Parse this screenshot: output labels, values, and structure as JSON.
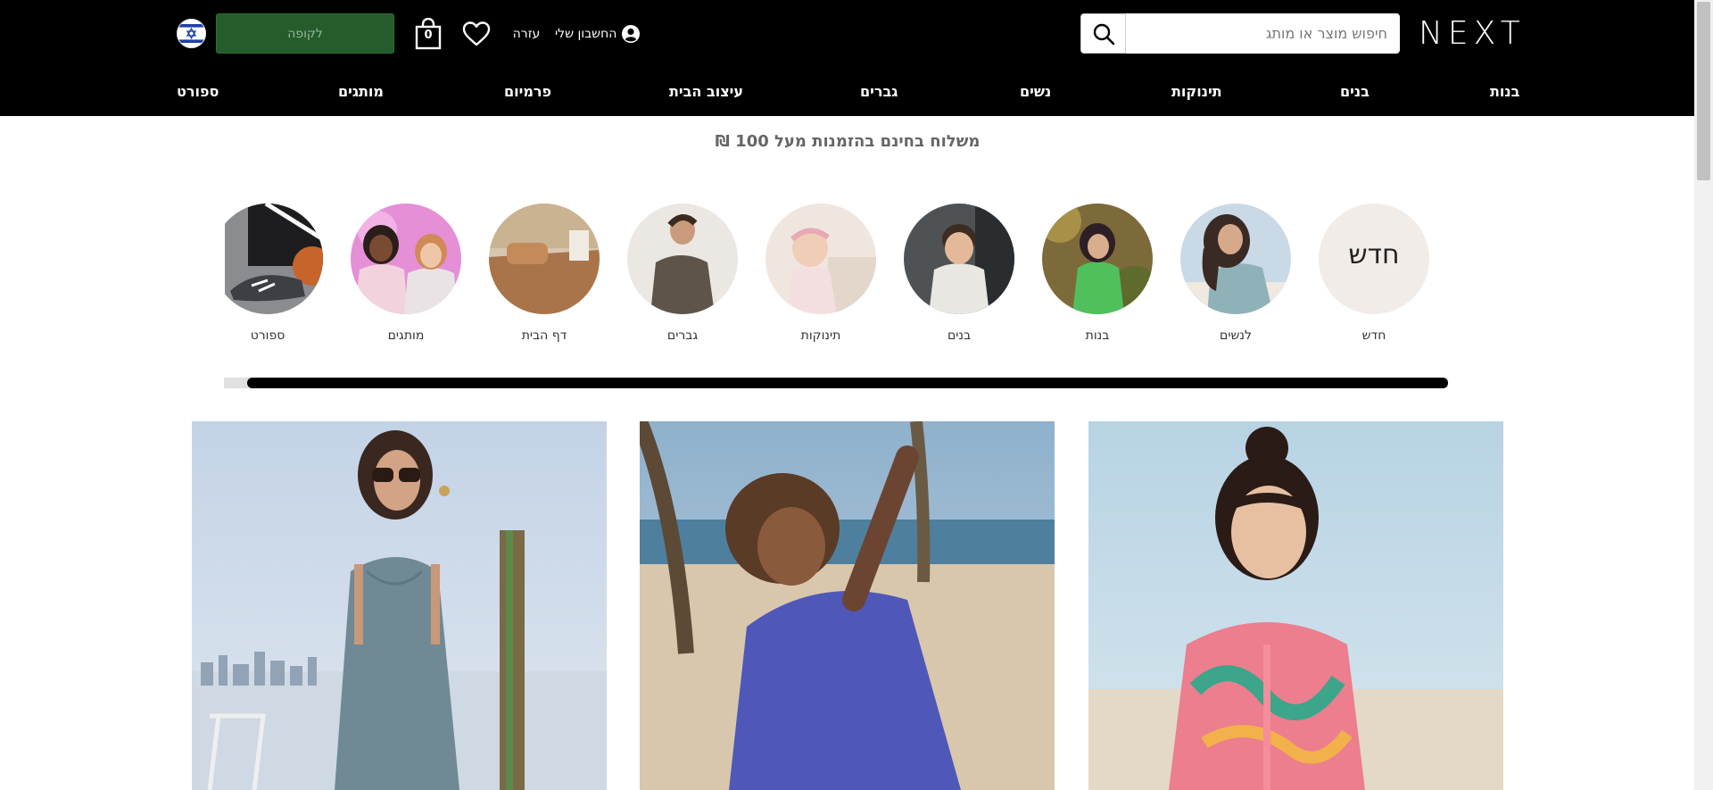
{
  "header": {
    "logo": "NEXT",
    "search_placeholder": "חיפוש מוצר או מותג",
    "account_label": "החשבון שלי",
    "help_label": "עזרה",
    "bag_count": "0",
    "checkout_label": "לקופה"
  },
  "nav": [
    "בנות",
    "בנים",
    "תינוקות",
    "נשים",
    "גברים",
    "עיצוב הבית",
    "פרמיום",
    "מותגים",
    "ספורט"
  ],
  "promo": "משלוח בחינם בהזמנות מעל 100 ₪",
  "categories": {
    "new_circle_text": "חדש",
    "labels": [
      "חדש",
      "לנשים",
      "בנות",
      "בנים",
      "תינוקות",
      "גברים",
      "דף הבית",
      "מותגים",
      "ספורט"
    ]
  },
  "colors": {
    "header_bg": "#000000",
    "checkout_bg": "#245c2b",
    "new_circle_bg": "#f1ece8"
  }
}
